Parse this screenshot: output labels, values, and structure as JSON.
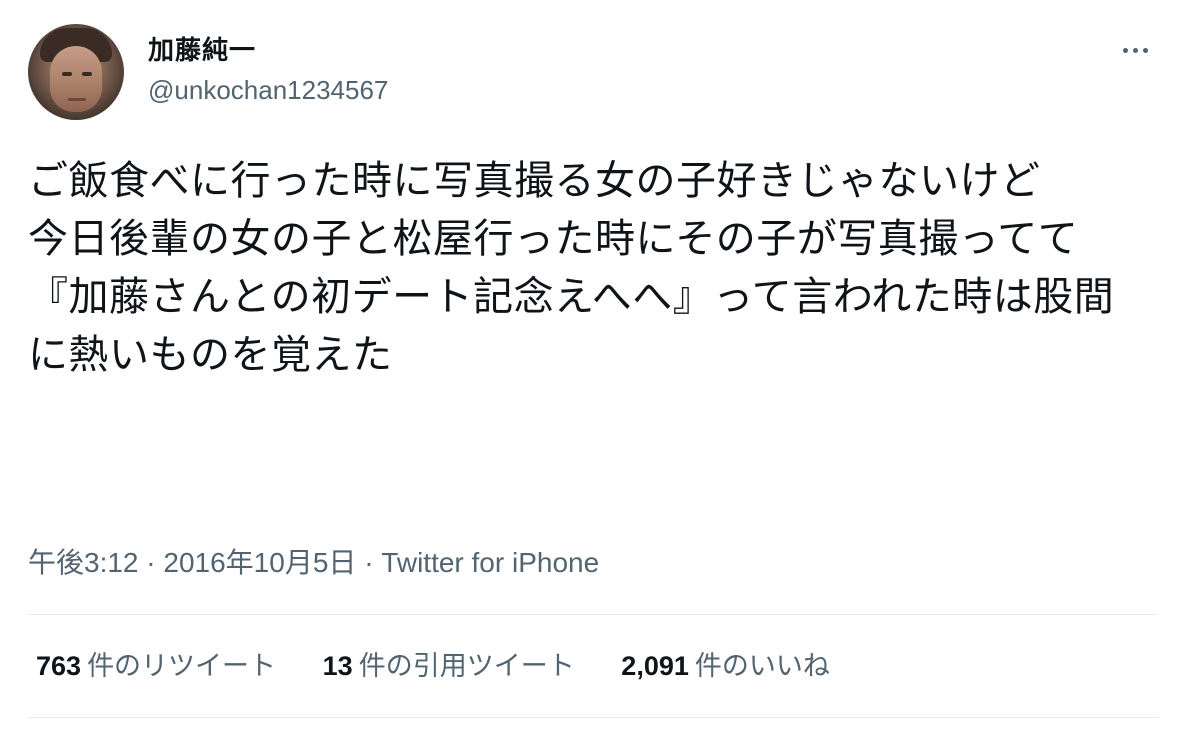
{
  "user": {
    "display_name": "加藤純一",
    "handle": "@unkochan1234567"
  },
  "tweet": {
    "text": "ご飯食べに行った時に写真撮る女の子好きじゃないけど\n今日後輩の女の子と松屋行った時にその子が写真撮ってて\n『加藤さんとの初デート記念えへへ』って言われた時は股間に熱いものを覚えた",
    "time": "午後3:12",
    "date": "2016年10月5日",
    "separator": "·",
    "source": "Twitter for iPhone"
  },
  "stats": {
    "retweets": {
      "count": "763",
      "label": "件のリツイート"
    },
    "quotes": {
      "count": "13",
      "label": "件の引用ツイート"
    },
    "likes": {
      "count": "2,091",
      "label": "件のいいね"
    }
  },
  "colors": {
    "text": "#0f1419",
    "secondary": "#536471",
    "divider": "#e7e9ea"
  },
  "icons": {
    "more": "more-horizontal-icon",
    "avatar": "avatar"
  }
}
